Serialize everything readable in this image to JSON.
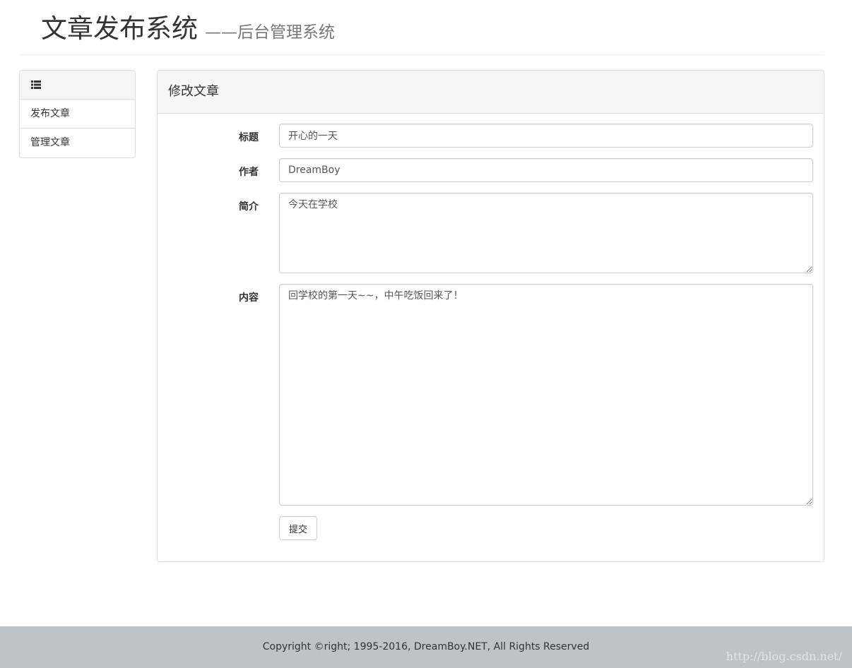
{
  "header": {
    "title": "文章发布系统",
    "subtitle": "——后台管理系统"
  },
  "sidebar": {
    "heading_icon": "list-icon",
    "items": [
      {
        "label": "发布文章"
      },
      {
        "label": "管理文章"
      }
    ]
  },
  "panel": {
    "title": "修改文章",
    "form": {
      "title_label": "标题",
      "title_value": "开心的一天",
      "author_label": "作者",
      "author_value": "DreamBoy",
      "summary_label": "简介",
      "summary_value": "今天在学校",
      "content_label": "内容",
      "content_value": "回学校的第一天~~，中午吃饭回来了！",
      "submit_label": "提交"
    }
  },
  "footer": {
    "copyright": "Copyright ©right; 1995-2016, DreamBoy.NET, All Rights Reserved",
    "watermark": "http://blog.csdn.net/"
  },
  "colors": {
    "footer_bg": "#bec3c7",
    "panel_heading_bg": "#f5f5f5",
    "border": "#dddddd"
  }
}
